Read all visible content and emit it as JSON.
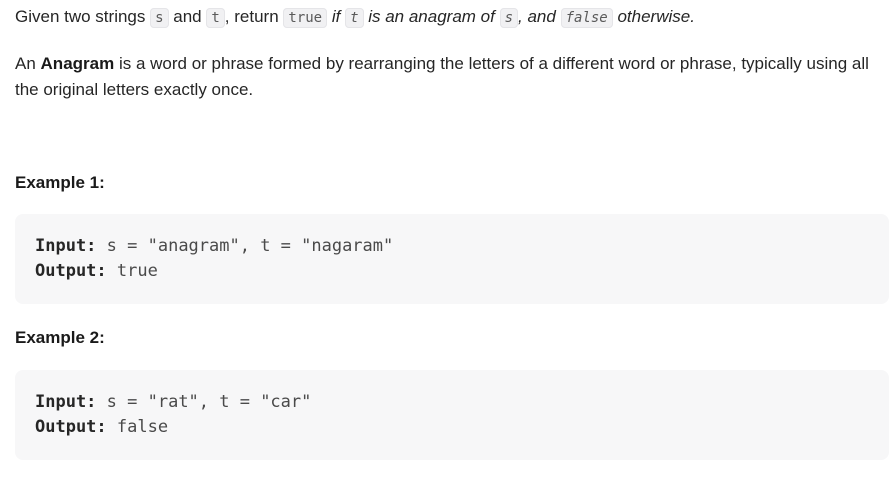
{
  "intro": {
    "p1": "Given two strings ",
    "s1": "s",
    "p2": " and ",
    "t1": "t",
    "p3": ", return ",
    "true_code": "true",
    "p4": " if ",
    "t2": "t",
    "p5": " is an anagram of ",
    "s2": "s",
    "p6": ", and ",
    "false_code": "false",
    "p7": " otherwise."
  },
  "definition": {
    "pre": "An ",
    "term": "Anagram",
    "post": " is a word or phrase formed by rearranging the letters of a different word or phrase, typically using all the original letters exactly once."
  },
  "examples": [
    {
      "title": "Example 1:",
      "input_label": "Input:",
      "input_value": "s = \"anagram\", t = \"nagaram\"",
      "output_label": "Output:",
      "output_value": "true"
    },
    {
      "title": "Example 2:",
      "input_label": "Input:",
      "input_value": "s = \"rat\", t = \"car\"",
      "output_label": "Output:",
      "output_value": "false"
    }
  ]
}
